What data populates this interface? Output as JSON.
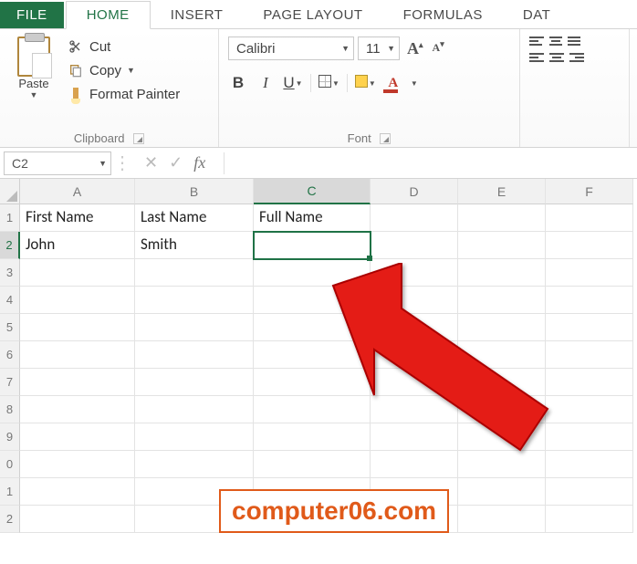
{
  "tabs": {
    "file": "FILE",
    "home": "HOME",
    "insert": "INSERT",
    "pageLayout": "PAGE LAYOUT",
    "formulas": "FORMULAS",
    "data": "DAT"
  },
  "clipboard": {
    "paste": "Paste",
    "cut": "Cut",
    "copy": "Copy",
    "formatPainter": "Format Painter",
    "groupTitle": "Clipboard"
  },
  "font": {
    "name": "Calibri",
    "size": "11",
    "groupTitle": "Font",
    "boldLabel": "B",
    "italicLabel": "I",
    "underlineLabel": "U",
    "fontColorLabel": "A"
  },
  "nameBox": {
    "value": "C2"
  },
  "formulaBar": {
    "fxLabel": "fx",
    "value": ""
  },
  "columns": [
    "A",
    "B",
    "C",
    "D",
    "E",
    "F"
  ],
  "rows": [
    "1",
    "2",
    "3",
    "4",
    "5",
    "6",
    "7",
    "8",
    "9",
    "0",
    "1",
    "2"
  ],
  "selectedCell": "C2",
  "cells": {
    "A1": "First Name",
    "B1": "Last Name",
    "C1": "Full Name",
    "A2": "John",
    "B2": "Smith"
  },
  "watermark": "computer06.com"
}
